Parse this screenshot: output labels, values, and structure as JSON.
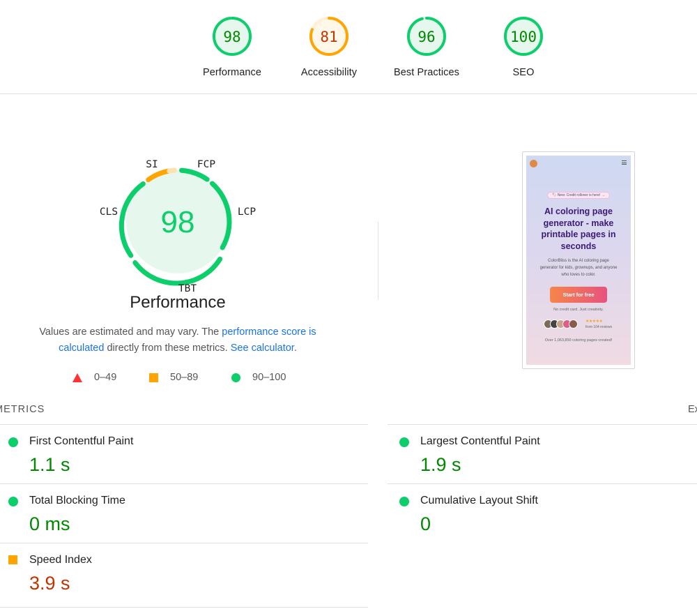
{
  "categories": [
    {
      "label": "Performance",
      "score": "98",
      "value": 98,
      "color": "#0cce6b",
      "bg": "#e6f8ed",
      "text": "#008800"
    },
    {
      "label": "Accessibility",
      "score": "81",
      "value": 81,
      "color": "#ffa400",
      "bg": "#fff7e8",
      "text": "#c33300"
    },
    {
      "label": "Best Practices",
      "score": "96",
      "value": 96,
      "color": "#0cce6b",
      "bg": "#e6f8ed",
      "text": "#008800"
    },
    {
      "label": "SEO",
      "score": "100",
      "value": 100,
      "color": "#0cce6b",
      "bg": "#e6f8ed",
      "text": "#008800"
    }
  ],
  "performance": {
    "score": "98",
    "title": "Performance",
    "metric_tags": {
      "si": "SI",
      "fcp": "FCP",
      "lcp": "LCP",
      "tbt": "TBT",
      "cls": "CLS"
    },
    "note_before": "Values are estimated and may vary. The ",
    "note_link": "performance score is calculated",
    "note_middle": " directly from these metrics. ",
    "note_link2": "See calculator",
    "note_after": "."
  },
  "legend": {
    "fail": "0–49",
    "average": "50–89",
    "pass": "90–100"
  },
  "screenshot": {
    "pill": "🏷 New: Credit rollover is here! →",
    "headline": "AI coloring page generator - make printable pages in seconds",
    "subtext": "ColorBliss is the AI coloring page generator for kids, grownups, and anyone who loves to color.",
    "button": "Start for free",
    "no_card": "No credit card. Just creativity.",
    "stars": "★★★★★",
    "reviews": "from 104 reviews",
    "created": "Over 1,063,850 coloring pages created!"
  },
  "metrics": {
    "heading": "METRICS",
    "expand": "Ex",
    "items": [
      {
        "title": "First Contentful Paint",
        "value": "1.1 s",
        "rating": "pass"
      },
      {
        "title": "Largest Contentful Paint",
        "value": "1.9 s",
        "rating": "pass"
      },
      {
        "title": "Total Blocking Time",
        "value": "0 ms",
        "rating": "pass"
      },
      {
        "title": "Cumulative Layout Shift",
        "value": "0",
        "rating": "pass"
      },
      {
        "title": "Speed Index",
        "value": "3.9 s",
        "rating": "average"
      }
    ]
  }
}
